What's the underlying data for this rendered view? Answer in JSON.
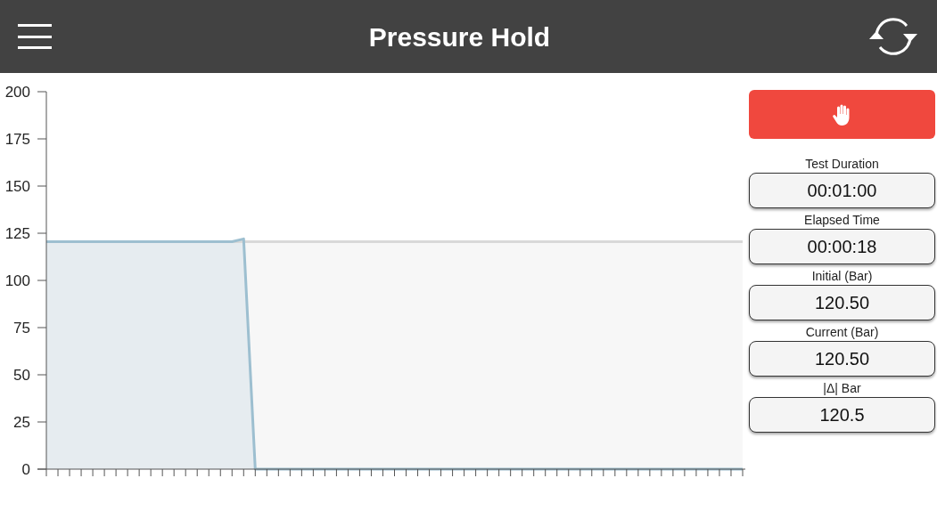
{
  "header": {
    "title": "Pressure Hold"
  },
  "chart": {
    "chart_data": {
      "type": "area",
      "ylim": [
        0,
        200
      ],
      "yticks": [
        0,
        25,
        50,
        75,
        100,
        125,
        150,
        175,
        200
      ],
      "series": [
        {
          "color": "#d9d9d9",
          "values": [
            120.5,
            120.5,
            120.5,
            120.5,
            120.5,
            120.5,
            120.5,
            120.5,
            120.5,
            120.5,
            120.5,
            120.5,
            120.5,
            120.5,
            120.5,
            120.5,
            120.5,
            120.5,
            120.5,
            120.5,
            120.5,
            120.5,
            120.5,
            120.5,
            120.5,
            120.5,
            120.5,
            120.5,
            120.5,
            120.5,
            120.5,
            120.5,
            120.5,
            120.5,
            120.5,
            120.5,
            120.5,
            120.5,
            120.5,
            120.5,
            120.5,
            120.5,
            120.5,
            120.5,
            120.5,
            120.5,
            120.5,
            120.5,
            120.5,
            120.5,
            120.5,
            120.5,
            120.5,
            120.5,
            120.5,
            120.5,
            120.5,
            120.5,
            120.5,
            120.5,
            120.5
          ]
        },
        {
          "color": "#9dbfd0",
          "values": [
            120.5,
            120.5,
            120.5,
            120.5,
            120.5,
            120.5,
            120.5,
            120.5,
            120.5,
            120.5,
            120.5,
            120.5,
            120.5,
            120.5,
            120.5,
            120.5,
            120.5,
            122,
            0,
            0,
            0,
            0,
            0,
            0,
            0,
            0,
            0,
            0,
            0,
            0,
            0,
            0,
            0,
            0,
            0,
            0,
            0,
            0,
            0,
            0,
            0,
            0,
            0,
            0,
            0,
            0,
            0,
            0,
            0,
            0,
            0,
            0,
            0,
            0,
            0,
            0,
            0,
            0,
            0,
            0,
            0
          ]
        }
      ]
    }
  },
  "stop_button": {
    "color": "#f0483e"
  },
  "readouts": [
    {
      "label": "Test Duration",
      "value": "00:01:00"
    },
    {
      "label": "Elapsed Time",
      "value": "00:00:18"
    },
    {
      "label": "Initial (Bar)",
      "value": "120.50"
    },
    {
      "label": "Current (Bar)",
      "value": "120.50"
    },
    {
      "label": "|Δ| Bar",
      "value": "120.5"
    }
  ]
}
